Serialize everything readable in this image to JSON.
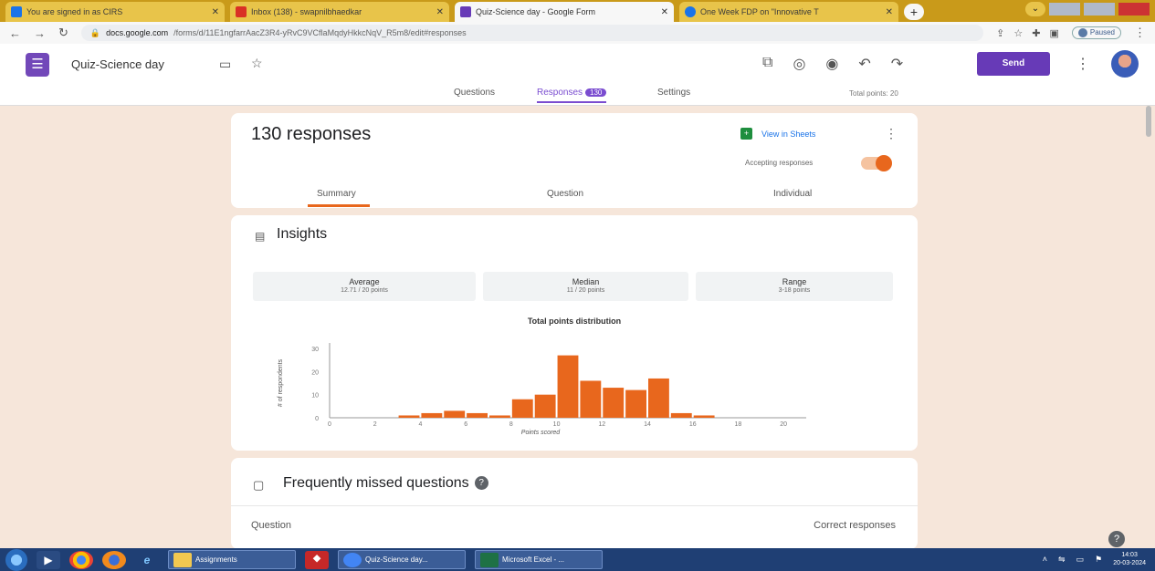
{
  "browser": {
    "tabs": [
      {
        "title": "You are signed in as CIRS",
        "color": "#1a73e8"
      },
      {
        "title": "Inbox (138) - swapnilbhaedkar",
        "color": "#d93025"
      },
      {
        "title": "Quiz-Science day - Google Form",
        "color": "#673ab7"
      },
      {
        "title": "One Week FDP on \"Innovative T",
        "color": "#1a73e8"
      }
    ],
    "url_host": "docs.google.com",
    "url_path": "/forms/d/11E1ngfarrAacZ3R4-yRvC9VCflaMqdyHkkcNqV_R5m8/edit#responses",
    "paused_label": "Paused"
  },
  "form": {
    "title": "Quiz-Science day",
    "send_label": "Send",
    "tabs": {
      "questions": "Questions",
      "responses": "Responses",
      "responses_count": "130",
      "settings": "Settings"
    },
    "total_points": "Total points: 20"
  },
  "responses": {
    "count_label": "130 responses",
    "view_in_sheets": "View in Sheets",
    "accepting": "Accepting responses",
    "accepting_on": true,
    "tabs": [
      "Summary",
      "Question",
      "Individual"
    ]
  },
  "insights": {
    "title": "Insights",
    "stats": [
      {
        "label": "Average",
        "value": "12.71 / 20 points"
      },
      {
        "label": "Median",
        "value": "11 / 20 points"
      },
      {
        "label": "Range",
        "value": "3-18 points"
      }
    ]
  },
  "chart_data": {
    "type": "bar",
    "title": "Total points distribution",
    "xlabel": "Points scored",
    "ylabel": "# of respondents",
    "x": [
      0,
      1,
      2,
      3,
      4,
      5,
      6,
      7,
      8,
      9,
      10,
      11,
      12,
      13,
      14,
      15,
      16,
      17,
      18,
      19,
      20
    ],
    "values": [
      0,
      0,
      0,
      1,
      2,
      3,
      2,
      1,
      8,
      10,
      27,
      16,
      13,
      12,
      17,
      2,
      1,
      0,
      0,
      0,
      0
    ],
    "xticks": [
      0,
      2,
      4,
      6,
      8,
      10,
      12,
      14,
      16,
      18,
      20
    ],
    "yticks": [
      0,
      10,
      20,
      30
    ],
    "ylim": [
      0,
      30
    ],
    "bar_color": "#e8671d"
  },
  "fmq": {
    "title": "Frequently missed questions",
    "col_question": "Question",
    "col_correct": "Correct responses"
  },
  "taskbar": {
    "tasks": [
      "Assignments",
      "Quiz-Science day...",
      "Microsoft Excel - ..."
    ],
    "time": "14:03",
    "date": "20-03-2024"
  }
}
